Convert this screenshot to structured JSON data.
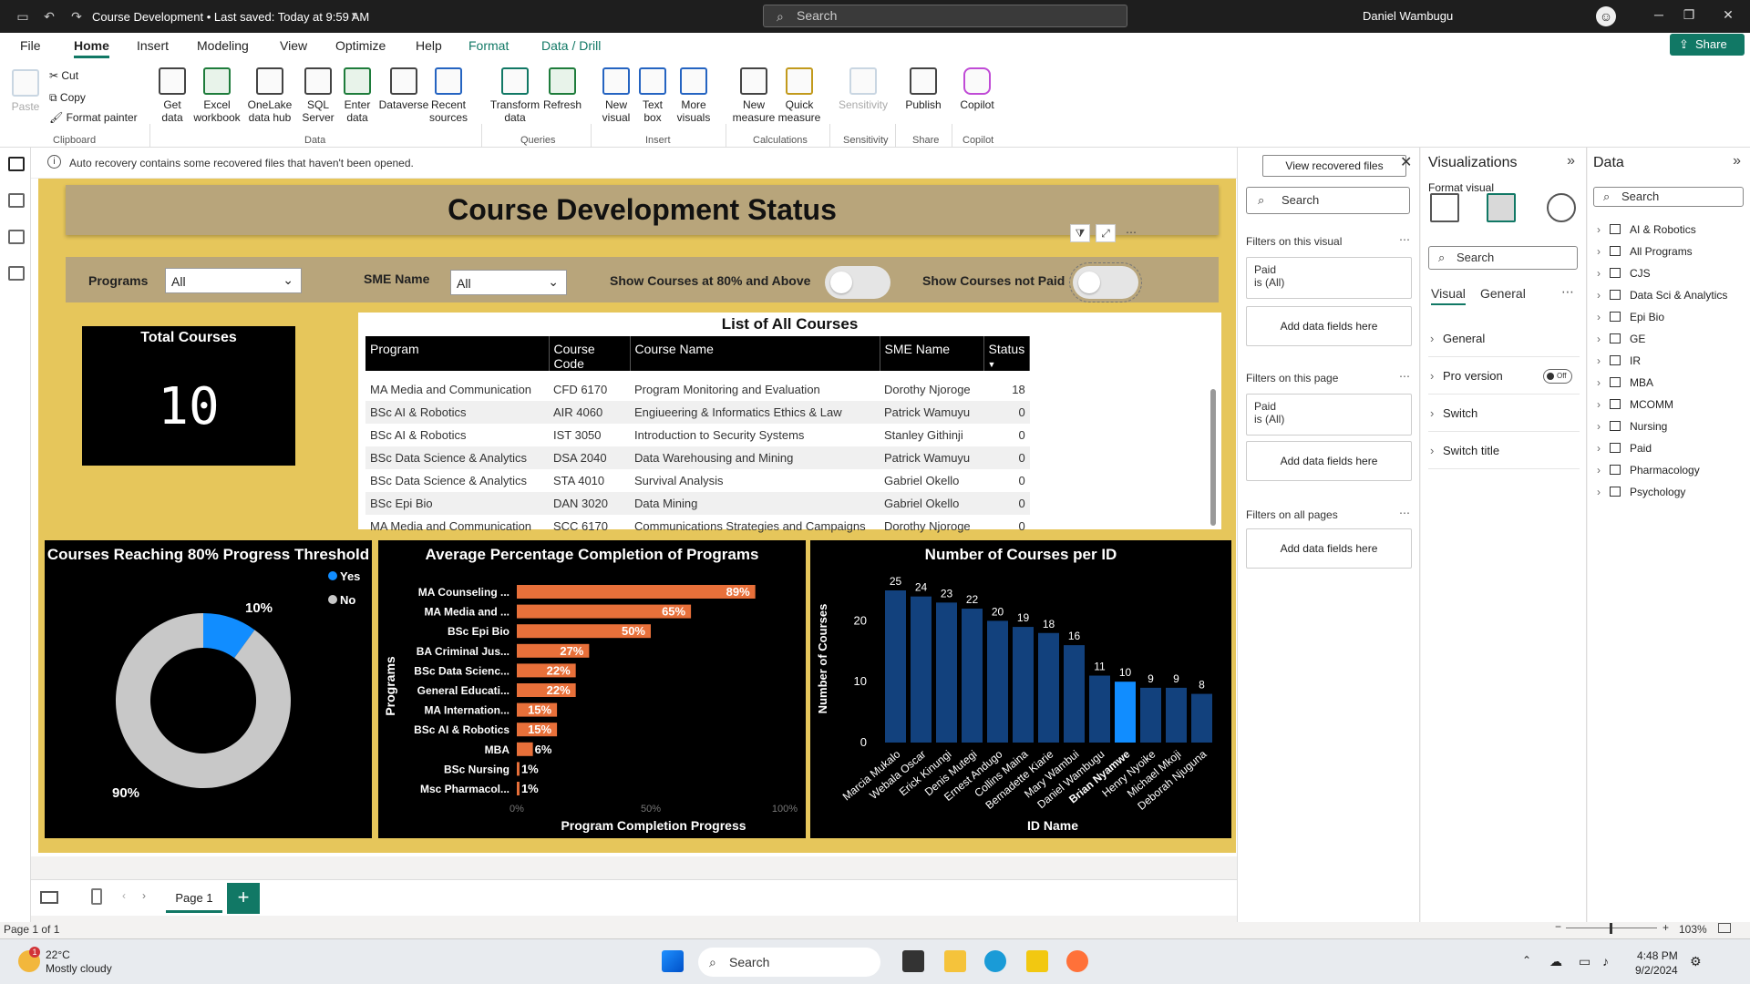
{
  "titlebar": {
    "doc_title": "Course Development • Last saved: Today at 9:59 AM",
    "search_placeholder": "Search",
    "user": "Daniel Wambugu"
  },
  "menu": {
    "tabs": [
      "File",
      "Home",
      "Insert",
      "Modeling",
      "View",
      "Optimize",
      "Help",
      "Format",
      "Data / Drill"
    ],
    "share": "Share"
  },
  "ribbon": {
    "clipboard": {
      "paste": "Paste",
      "cut": "Cut",
      "copy": "Copy",
      "format_painter": "Format painter",
      "group": "Clipboard"
    },
    "data": {
      "get_data": "Get data",
      "excel": "Excel workbook",
      "onelake": "OneLake data hub",
      "sql": "SQL Server",
      "enter": "Enter data",
      "dataverse": "Dataverse",
      "recent": "Recent sources",
      "group": "Data"
    },
    "queries": {
      "transform": "Transform data",
      "refresh": "Refresh",
      "group": "Queries"
    },
    "insert": {
      "new_visual": "New visual",
      "text_box": "Text box",
      "more_visuals": "More visuals",
      "group": "Insert"
    },
    "calculations": {
      "new_measure": "New measure",
      "quick_measure": "Quick measure",
      "group": "Calculations"
    },
    "sensitivity": {
      "label": "Sensitivity",
      "group": "Sensitivity"
    },
    "share": {
      "publish": "Publish",
      "group": "Share"
    },
    "copilot": {
      "label": "Copilot",
      "group": "Copilot"
    }
  },
  "notice": {
    "text": "Auto recovery contains some recovered files that haven't been opened.",
    "button": "View recovered files"
  },
  "report": {
    "title": "Course Development Status",
    "slicers": {
      "programs_label": "Programs",
      "programs_value": "All",
      "sme_label": "SME Name",
      "sme_value": "All",
      "toggle1_label": "Show Courses at 80% and Above",
      "toggle2_label": "Show Courses not Paid"
    },
    "card": {
      "title": "Total Courses",
      "value": "10"
    },
    "table": {
      "title": "List of All Courses",
      "columns": [
        "Program",
        "Course Code",
        "Course Name",
        "SME Name",
        "Status"
      ],
      "rows": [
        [
          "MA Media and Communication",
          "CFD 6170",
          "Program Monitoring and Evaluation",
          "Dorothy Njoroge",
          "18"
        ],
        [
          "BSc AI & Robotics",
          "AIR 4060",
          "Engiueering & Informatics Ethics & Law",
          "Patrick Wamuyu",
          "0"
        ],
        [
          "BSc AI & Robotics",
          "IST 3050",
          "Introduction to Security Systems",
          "Stanley Githinji",
          "0"
        ],
        [
          "BSc Data Science & Analytics",
          "DSA 2040",
          "Data Warehousing and Mining",
          "Patrick Wamuyu",
          "0"
        ],
        [
          "BSc Data Science & Analytics",
          "STA 4010",
          "Survival Analysis",
          "Gabriel Okello",
          "0"
        ],
        [
          "BSc Epi Bio",
          "DAN 3020",
          "Data Mining",
          "Gabriel Okello",
          "0"
        ],
        [
          "MA Media and Communication",
          "SCC 6170",
          "Communications Strategies and Campaigns",
          "Dorothy Njoroge",
          "0"
        ]
      ]
    }
  },
  "chart_data": [
    {
      "type": "pie",
      "title": "Courses Reaching 80% Progress Threshold",
      "categories": [
        "Yes",
        "No"
      ],
      "values": [
        10,
        90
      ],
      "labels": [
        "10%",
        "90%"
      ],
      "colors": [
        "#118dff",
        "#c8c8c8"
      ],
      "legend": "top-right"
    },
    {
      "type": "bar",
      "title": "Average Percentage Completion of Programs",
      "xlabel": "Program Completion Progress",
      "ylabel": "Programs",
      "categories": [
        "MA Counseling ...",
        "MA Media and ...",
        "BSc Epi Bio",
        "BA Criminal Jus...",
        "BSc Data Scienc...",
        "General Educati...",
        "MA Internation...",
        "BSc AI & Robotics",
        "MBA",
        "BSc Nursing",
        "Msc Pharmacol..."
      ],
      "values": [
        89,
        65,
        50,
        27,
        22,
        22,
        15,
        15,
        6,
        1,
        1
      ],
      "labels": [
        "89%",
        "65%",
        "50%",
        "27%",
        "22%",
        "22%",
        "15%",
        "15%",
        "6%",
        "1%",
        "1%"
      ],
      "ticks": [
        "0%",
        "50%",
        "100%"
      ],
      "xlim": [
        0,
        100
      ],
      "color": "#e8703a"
    },
    {
      "type": "bar",
      "title": "Number of Courses per ID",
      "xlabel": "ID Name",
      "ylabel": "Number of Courses",
      "categories": [
        "Marcia Mukalo",
        "Webala Oscar",
        "Erick Kinungi",
        "Denis Mutegi",
        "Ernest Andugo",
        "Collins Maina",
        "Bernadette Kiarie",
        "Mary Wambui",
        "Daniel Wambugu",
        "Brian Nyamwe",
        "Henry Nyoike",
        "Michael Mkoji",
        "Deborah Njuguna"
      ],
      "values": [
        25,
        24,
        23,
        22,
        20,
        19,
        18,
        16,
        11,
        10,
        9,
        9,
        8
      ],
      "ticks": [
        "0",
        "10",
        "20"
      ],
      "ylim": [
        0,
        25
      ],
      "color": "#12417d",
      "highlight_color": "#118dff",
      "highlight": "Brian Nyamwe"
    }
  ],
  "filters": {
    "search": "Search",
    "on_visual": "Filters on this visual",
    "on_page": "Filters on this page",
    "on_all": "Filters on all pages",
    "paid_title": "Paid",
    "paid_value": "is (All)",
    "add": "Add data fields here"
  },
  "viz": {
    "title": "Visualizations",
    "subtitle": "Format visual",
    "search": "Search",
    "tab_visual": "Visual",
    "tab_general": "General",
    "sections": [
      "General",
      "Pro version",
      "Switch",
      "Switch title"
    ],
    "pro_toggle": "Off"
  },
  "data": {
    "title": "Data",
    "search": "Search",
    "tables": [
      "AI & Robotics",
      "All Programs",
      "CJS",
      "Data Sci & Analytics",
      "Epi Bio",
      "GE",
      "IR",
      "MBA",
      "MCOMM",
      "Nursing",
      "Paid",
      "Pharmacology",
      "Psychology"
    ]
  },
  "pages": {
    "current": "Page 1",
    "status": "Page 1 of 1",
    "zoom": "103%"
  },
  "taskbar": {
    "temp": "22°C",
    "weather": "Mostly cloudy",
    "search": "Search",
    "time": "4:48 PM",
    "date": "9/2/2024"
  }
}
